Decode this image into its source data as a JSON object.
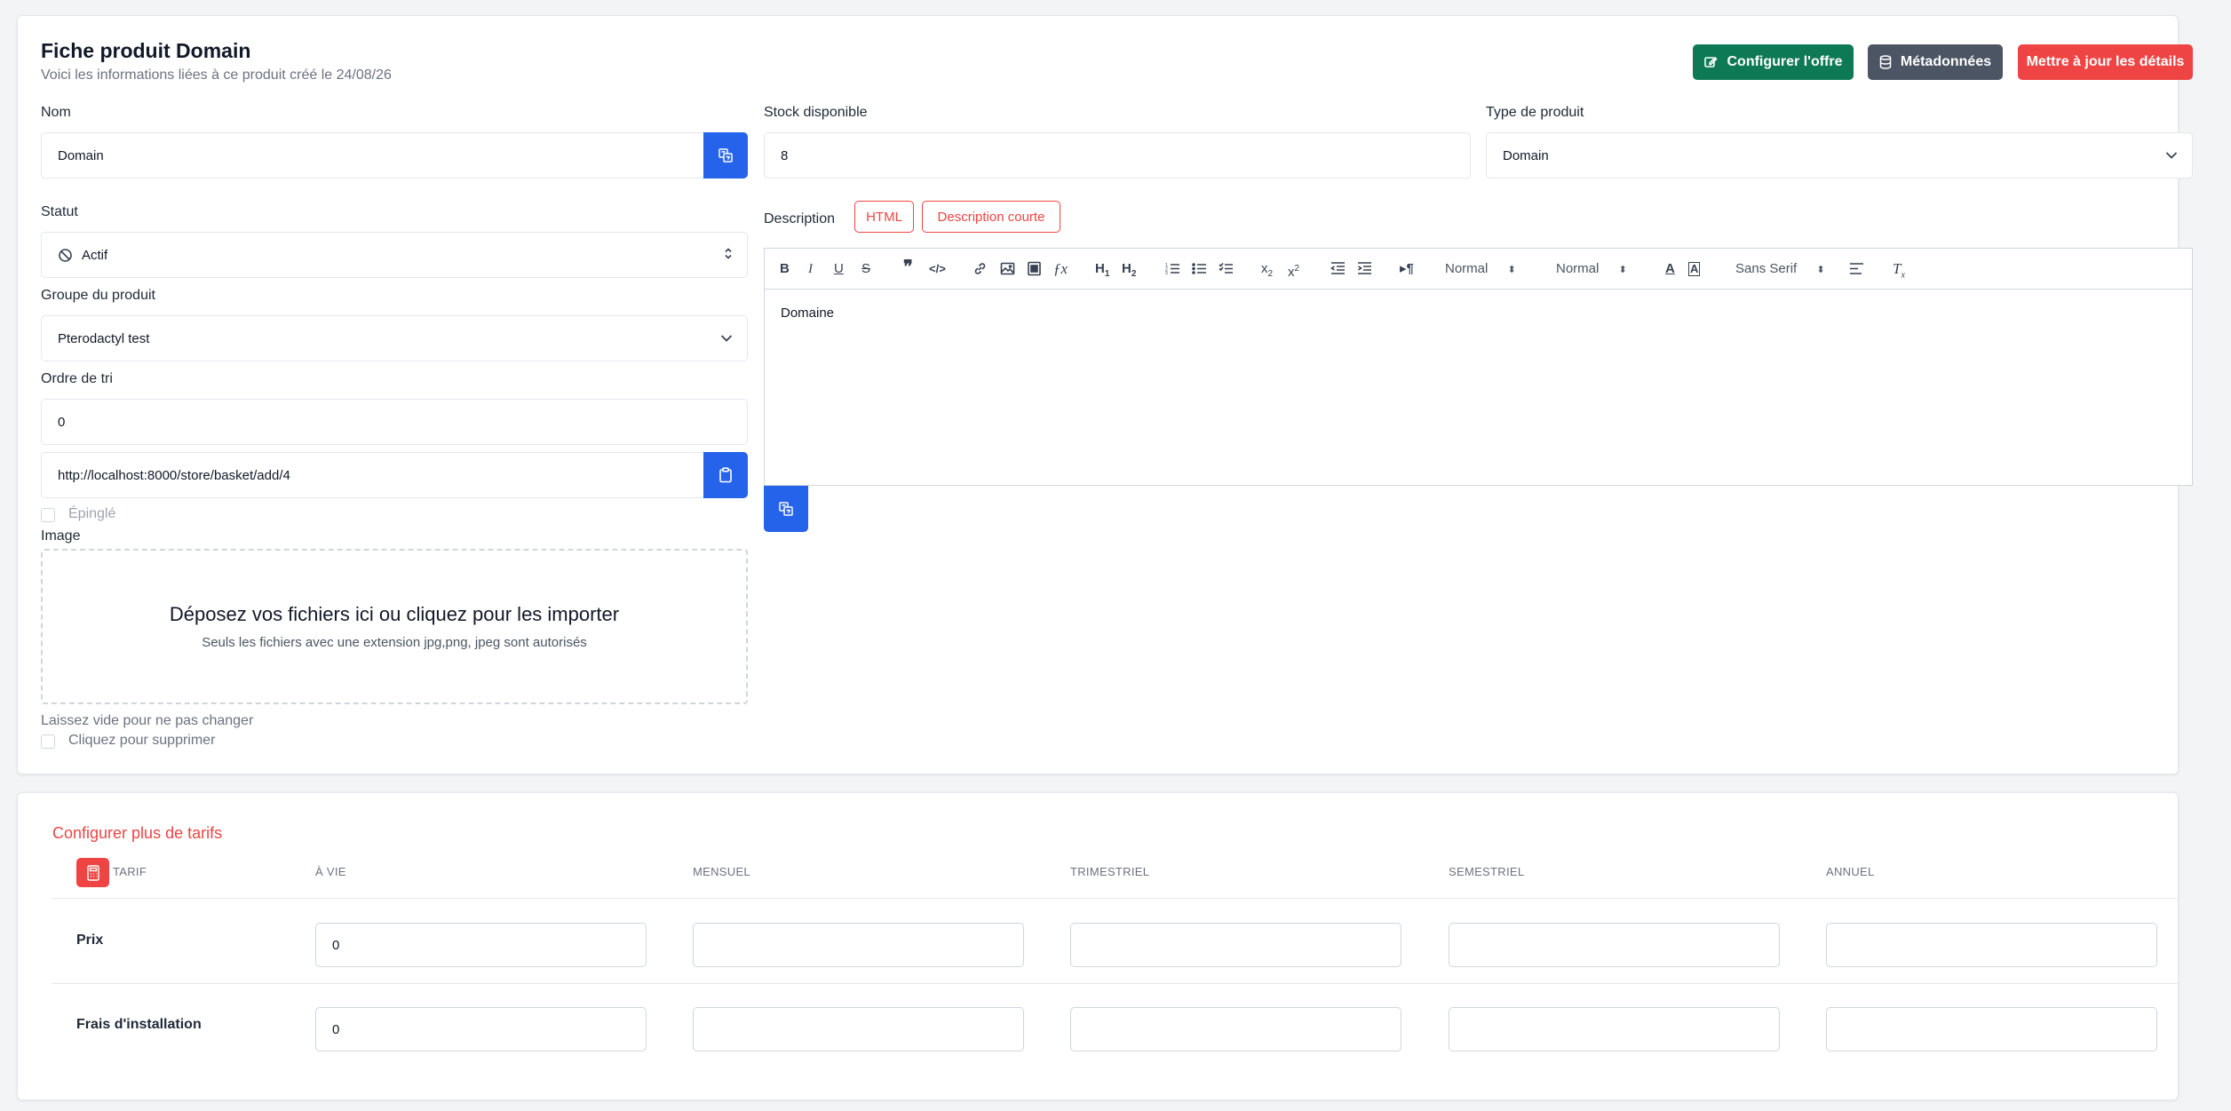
{
  "header": {
    "title": "Fiche produit Domain",
    "subtitle": "Voici les informations liées à ce produit créé le 24/08/26",
    "buttons": {
      "configure": "Configurer l'offre",
      "metadata": "Métadonnées",
      "update": "Mettre à jour les détails"
    }
  },
  "form": {
    "name": {
      "label": "Nom",
      "value": "Domain"
    },
    "stock": {
      "label": "Stock disponible",
      "value": "8"
    },
    "type": {
      "label": "Type de produit",
      "value": "Domain"
    },
    "status": {
      "label": "Statut",
      "value": "Actif"
    },
    "group": {
      "label": "Groupe du produit",
      "value": "Pterodactyl test"
    },
    "sort": {
      "label": "Ordre de tri",
      "value": "0"
    },
    "url": {
      "value": "http://localhost:8000/store/basket/add/4"
    },
    "pinned": {
      "label": "Épinglé"
    },
    "image": {
      "label": "Image",
      "drop_title": "Déposez vos fichiers ici ou cliquez pour les importer",
      "drop_sub": "Seuls les fichiers avec une extension jpg,png, jpeg sont autorisés",
      "hint": "Laissez vide pour ne pas changer",
      "remove_label": "Cliquez pour supprimer"
    },
    "description": {
      "label": "Description",
      "tab_html": "HTML",
      "tab_short": "Description courte",
      "content": "Domaine",
      "toolbar": {
        "header_select": "Normal",
        "size_select": "Normal",
        "font_select": "Sans Serif"
      }
    }
  },
  "pricing": {
    "title": "Configurer plus de tarifs",
    "columns": [
      "TARIF",
      "À VIE",
      "MENSUEL",
      "TRIMESTRIEL",
      "SEMESTRIEL",
      "ANNUEL"
    ],
    "rows": [
      {
        "label": "Prix",
        "values": [
          "0",
          "",
          "",
          "",
          ""
        ]
      },
      {
        "label": "Frais d'installation",
        "values": [
          "0",
          "",
          "",
          "",
          ""
        ]
      }
    ]
  },
  "colors": {
    "primary": "#2563eb",
    "success": "#0e7a55",
    "secondary": "#4b5563",
    "danger": "#ef4444"
  }
}
